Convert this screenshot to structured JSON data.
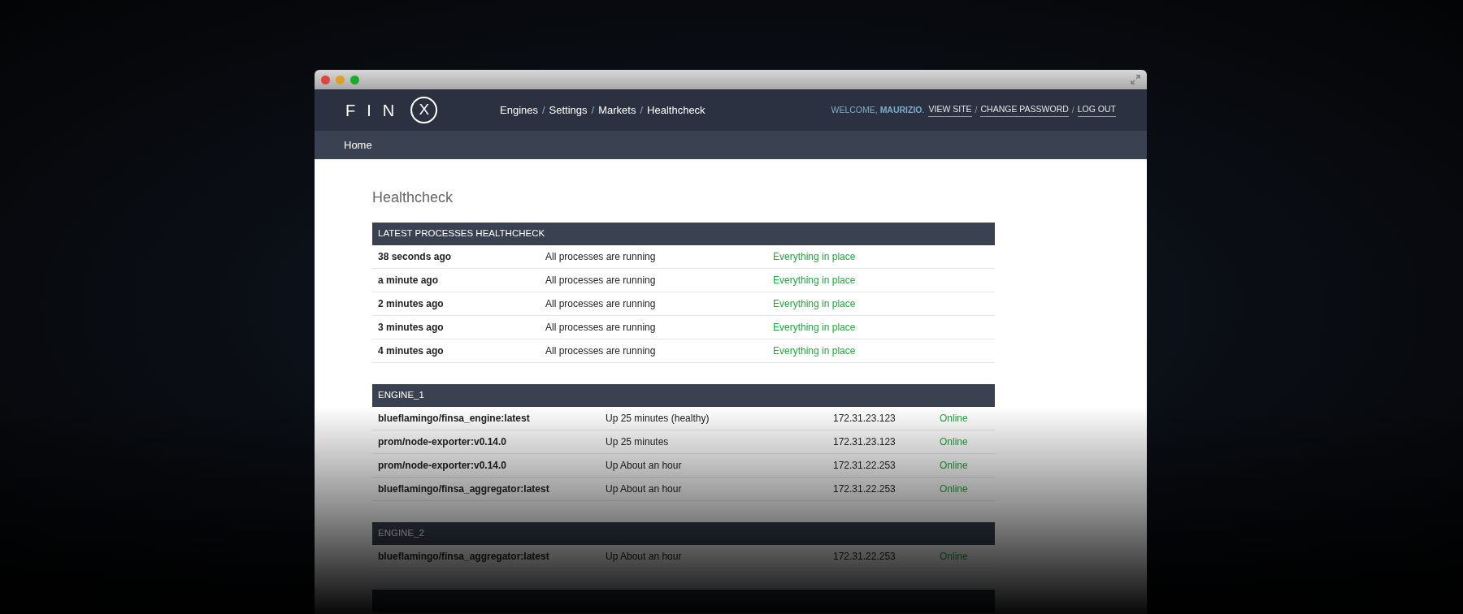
{
  "nav": {
    "logo": {
      "letters": "FIN",
      "badge": "X"
    },
    "breadcrumbs": [
      "Engines",
      "Settings",
      "Markets",
      "Healthcheck"
    ],
    "breadcrumb_separator": "/",
    "user": {
      "welcome": "WELCOME, **MAURIZIO**.",
      "links": [
        "VIEW SITE",
        "CHANGE PASSWORD",
        "LOG OUT"
      ],
      "link_separator": "/"
    }
  },
  "subnav": {
    "label": "Home"
  },
  "page_title": "Healthcheck",
  "healthcheck": {
    "title": "LATEST PROCESSES HEALTHCHECK",
    "rows": [
      {
        "time": "38 seconds ago",
        "message": "All processes are running",
        "status": "Everything in place",
        "color": "#1faa3c"
      },
      {
        "time": "a minute ago",
        "message": "All processes are running",
        "status": "Everything in place",
        "color": "#1faa3c"
      },
      {
        "time": "2 minutes ago",
        "message": "All processes are running",
        "status": "Everything in place",
        "color": "#1faa3c"
      },
      {
        "time": "3 minutes ago",
        "message": "All processes are running",
        "status": "Everything in place",
        "color": "#1faa3c"
      },
      {
        "time": "4 minutes ago",
        "message": "All processes are running",
        "status": "Everything in place",
        "color": "#1faa3c"
      }
    ]
  },
  "engines": [
    {
      "title": "ENGINE_1",
      "rows": [
        {
          "image": "blueflamingo/finsa_engine:latest",
          "uptime": "Up 25 minutes (healthy)",
          "ip": "172.31.23.123",
          "status": "Online"
        },
        {
          "image": "prom/node-exporter:v0.14.0",
          "uptime": "Up 25 minutes",
          "ip": "172.31.23.123",
          "status": "Online"
        },
        {
          "image": "prom/node-exporter:v0.14.0",
          "uptime": "Up About an hour",
          "ip": "172.31.22.253",
          "status": "Online"
        },
        {
          "image": "blueflamingo/finsa_aggregator:latest",
          "uptime": "Up About an hour",
          "ip": "172.31.22.253",
          "status": "Online"
        }
      ]
    },
    {
      "title": "ENGINE_2",
      "rows": [
        {
          "image": "blueflamingo/finsa_aggregator:latest",
          "uptime": "Up About an hour",
          "ip": "172.31.22.253",
          "status": "Online"
        }
      ]
    }
  ]
}
